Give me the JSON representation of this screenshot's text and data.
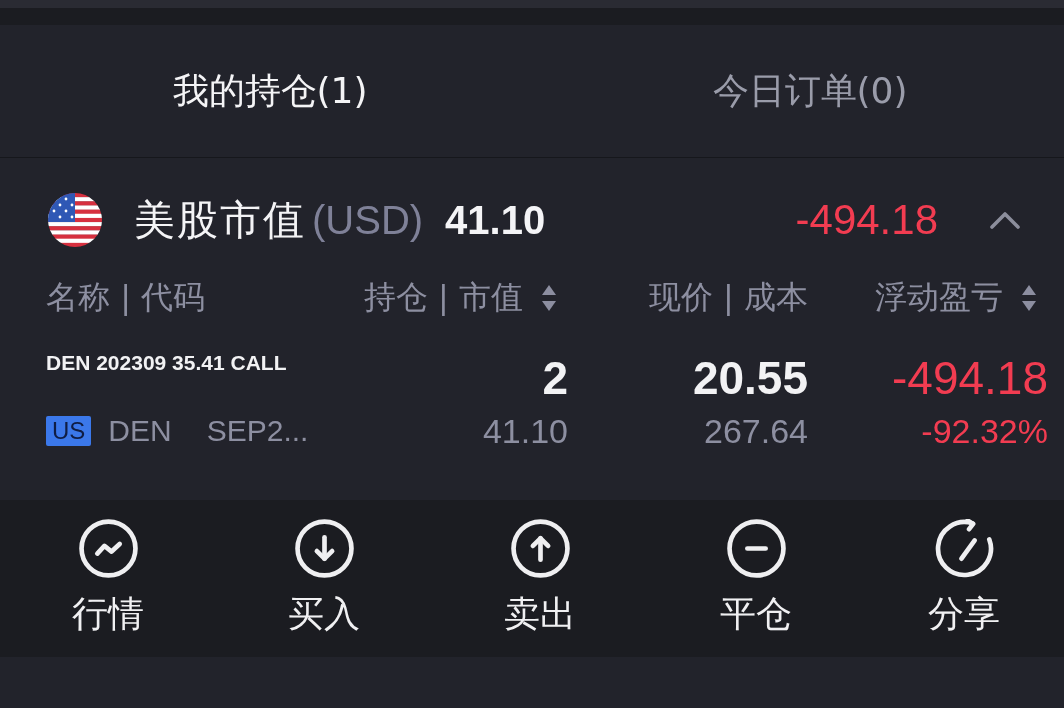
{
  "tabs": [
    {
      "label": "我的持仓(1)",
      "selected": true
    },
    {
      "label": "今日订单(0)",
      "selected": false
    }
  ],
  "market_section": {
    "title": "美股市值",
    "currency": "(USD)",
    "market_value": "41.10",
    "profit_loss": "-494.18",
    "negative": true,
    "expanded": true
  },
  "columns": [
    {
      "label": "名称 | 代码",
      "sortable": false
    },
    {
      "label": "持仓 | 市值",
      "sortable": true
    },
    {
      "label": "现价 | 成本",
      "sortable": false
    },
    {
      "label": "浮动盈亏",
      "sortable": true
    }
  ],
  "positions": [
    {
      "name": "DEN 202309 35.41 CALL",
      "market": "US",
      "symbol": "DEN",
      "expiry": "SEP2...",
      "quantity": "2",
      "market_value": "41.10",
      "price": "20.55",
      "cost": "267.64",
      "pnl": "-494.18",
      "pnl_percent": "-92.32%",
      "negative": true
    }
  ],
  "actions": [
    {
      "label": "行情",
      "kind": "quote"
    },
    {
      "label": "买入",
      "kind": "buy"
    },
    {
      "label": "卖出",
      "kind": "sell"
    },
    {
      "label": "平仓",
      "kind": "close"
    },
    {
      "label": "分享",
      "kind": "share"
    }
  ]
}
